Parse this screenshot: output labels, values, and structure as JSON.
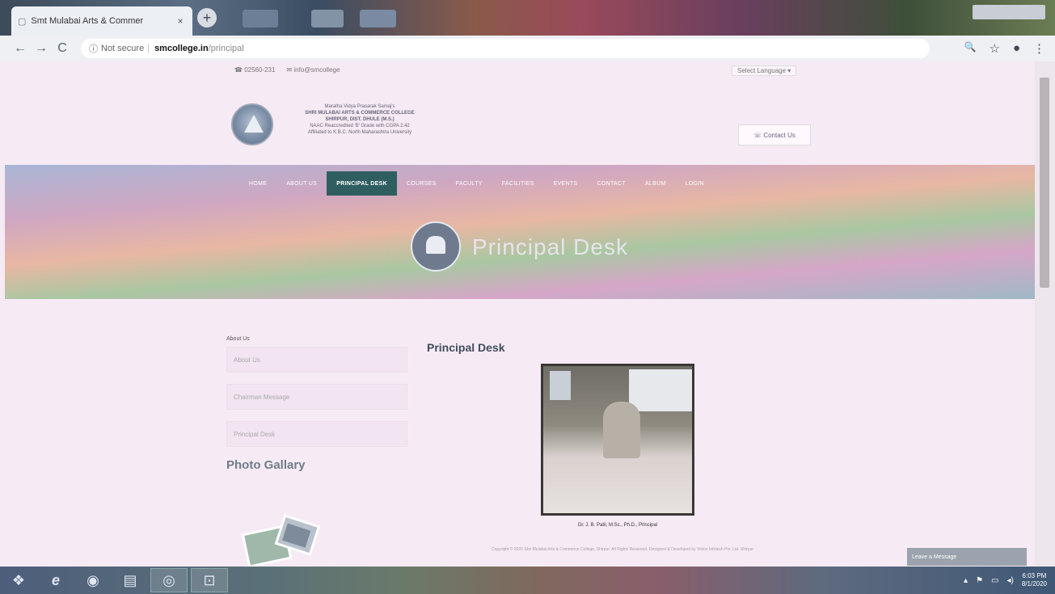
{
  "browser": {
    "tab_title": "Smt Mulabai Arts & Commer",
    "tab_close": "×",
    "new_tab": "+",
    "secure_label": "Not secure",
    "url_host": "smcollege.in",
    "url_path": "/principal",
    "back": "←",
    "forward": "→",
    "reload": "C",
    "info": "ⓘ",
    "zoom_icon": "🔍",
    "star_icon": "☆",
    "profile_icon": "●",
    "menu_icon": "⋮"
  },
  "site": {
    "topbar_left": [
      "☎ 02560-231",
      "✉ info@smcollege"
    ],
    "topbar_right": "Select Language ▾",
    "college_lines": [
      "Maratha Vidya Prasarak Samaj's",
      "SHRI MULABAI ARTS & COMMERCE COLLEGE",
      "SHIRPUR, DIST. DHULE (M.S.)",
      "NAAC Reaccredited 'B' Grade with CGPA 2.42",
      "Affiliated to K.B.C. North Maharashtra University"
    ],
    "contact_button": "☏ Contact Us",
    "nav": [
      "HOME",
      "ABOUT US",
      "PRINCIPAL DESK",
      "COURSES",
      "FACULTY",
      "FACILITIES",
      "EVENTS",
      "CONTACT",
      "ALBUM",
      "LOGIN"
    ],
    "banner_title": "Principal Desk",
    "sidebar": {
      "label": "About Us",
      "links": [
        "About Us",
        "Chairman Message",
        "Principal Desk"
      ],
      "gallery_title": "Photo Gallary"
    },
    "main": {
      "title": "Principal Desk",
      "caption": "Dr. J. B. Patil, M.Sc., Ph.D., Principal",
      "footer_note": "Copyright © 2020 Shri Mulabai Arts & Commerce College, Shirpur. All Rights Reserved. Designed & Developed by Vision Infotech Pvt. Ltd. Shirpur"
    },
    "chat_button": "Leave a Message"
  },
  "taskbar": {
    "start_icon": "❖",
    "ie_icon": "e",
    "media_icon": "◉",
    "explorer_icon": "▤",
    "chrome_icon": "◎",
    "app_icon": "⊡",
    "tray": [
      "▴",
      "⚑",
      "▭",
      "◂)"
    ],
    "time": "6:03 PM",
    "date": "8/1/2020"
  }
}
